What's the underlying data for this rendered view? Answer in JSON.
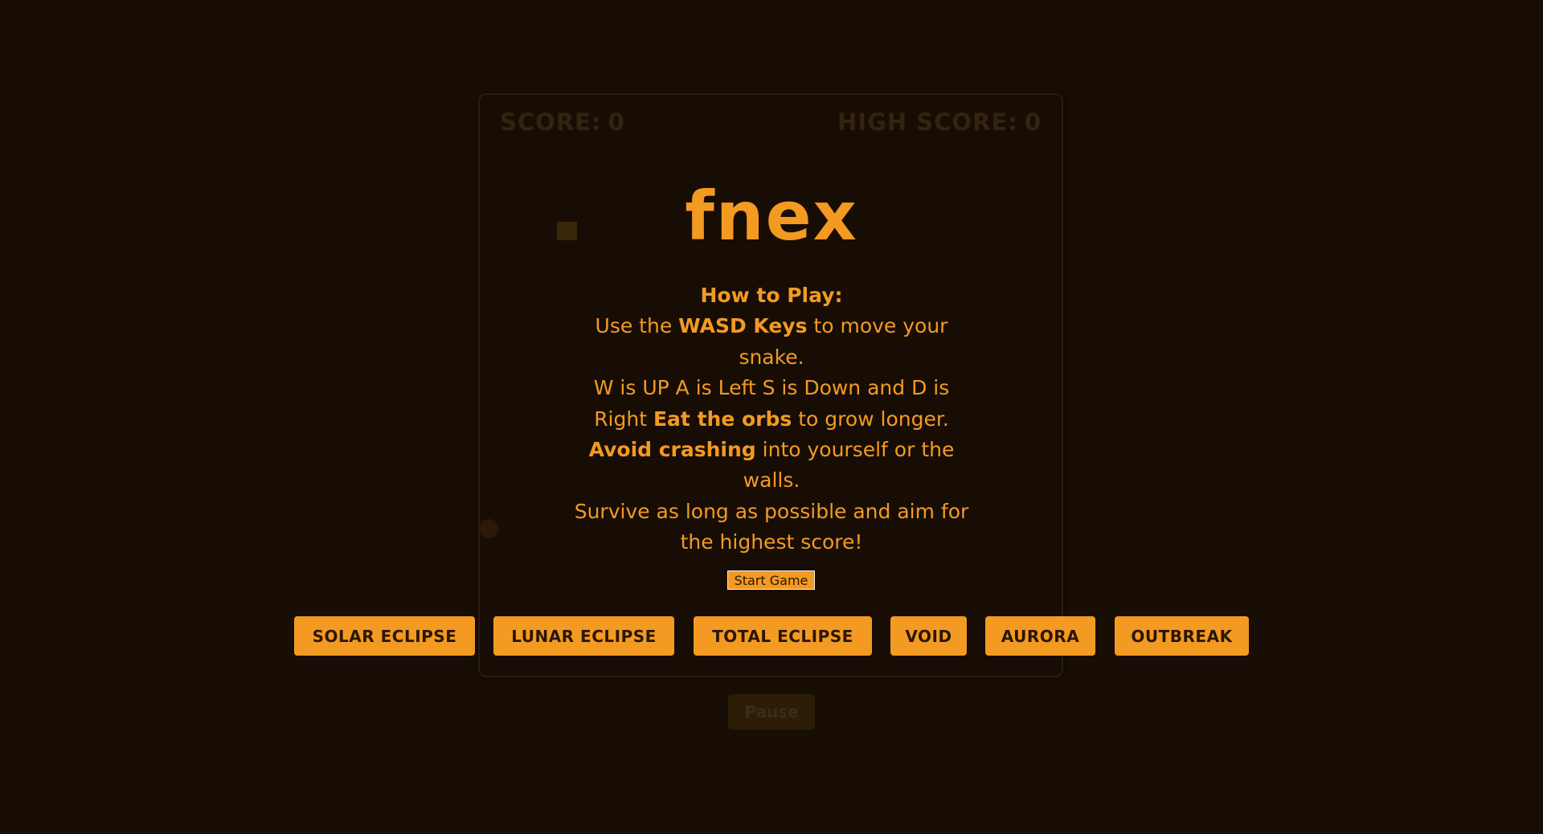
{
  "scoreboard": {
    "score_label": "SCORE:",
    "score_value": "0",
    "high_score_label": "HIGH SCORE:",
    "high_score_value": "0"
  },
  "title": "fnex",
  "how_to_play": {
    "heading": "How to Play:",
    "line1_pre": "Use the ",
    "line1_bold": "WASD Keys",
    "line1_post": " to move your snake.",
    "line2_pre": "W is UP A is Left S is Down and D is Right ",
    "line2_bold": "Eat the orbs",
    "line2_post": " to grow longer.",
    "line3_bold": "Avoid crashing",
    "line3_post": " into yourself or the walls.",
    "line4": "Survive as long as possible and aim for the highest score!"
  },
  "start_button": "Start Game",
  "themes": [
    "SOLAR ECLIPSE",
    "LUNAR ECLIPSE",
    "TOTAL ECLIPSE",
    "VOID",
    "AURORA",
    "OUTBREAK"
  ],
  "pause_button": "Pause",
  "colors": {
    "background": "#180e05",
    "accent": "#f39a22",
    "button_text": "#2b1604",
    "dim_text": "#33230f"
  }
}
